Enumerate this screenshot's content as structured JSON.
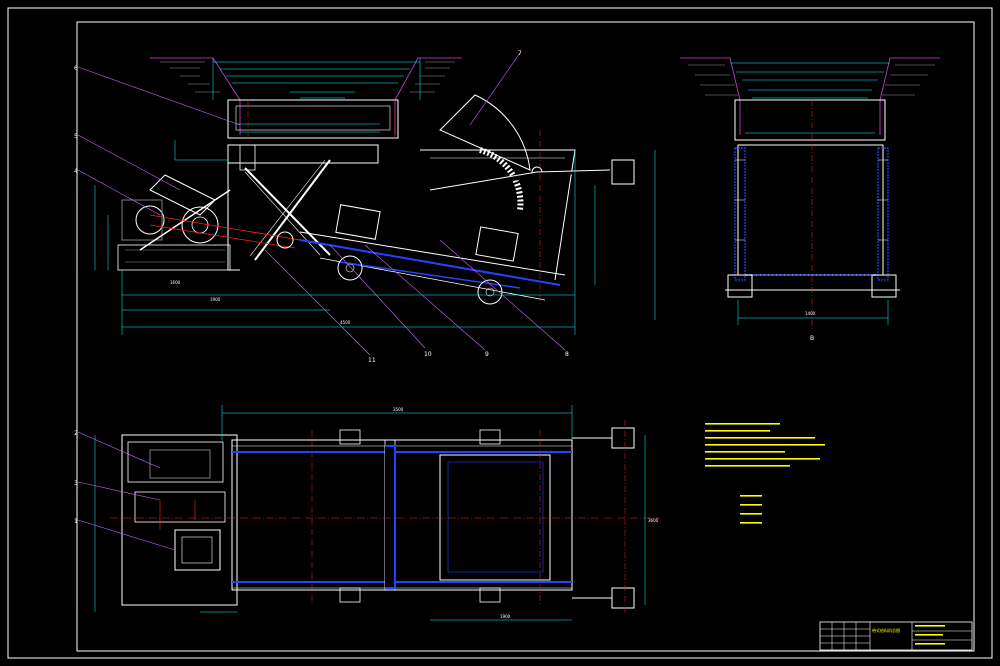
{
  "colors": {
    "background": "#000000",
    "frame": "#ffffff",
    "outline": "#ffffff",
    "dimension": "#00ffff",
    "centerline": "#ff2020",
    "belt": "#2244ff",
    "leader": "#cc66ff",
    "notes": "#ffff00",
    "grey": "#9a9a9a",
    "hatch": "#d040d0"
  },
  "labels": {
    "front": [
      "6",
      "5",
      "4",
      "7"
    ],
    "front_bottom": [
      "11",
      "10",
      "9",
      "8"
    ],
    "plan": [
      "2",
      "3",
      "1"
    ],
    "side_bottom": "B"
  },
  "dimensions": {
    "front_overall": "4500",
    "front_bottom": "1900",
    "front_sub": "1600",
    "side_bottom": "1400",
    "plan_top": "3500",
    "plan_right": "3600",
    "plan_bottom": "1900"
  },
  "title_block": {
    "name": "带式给料机总图"
  }
}
